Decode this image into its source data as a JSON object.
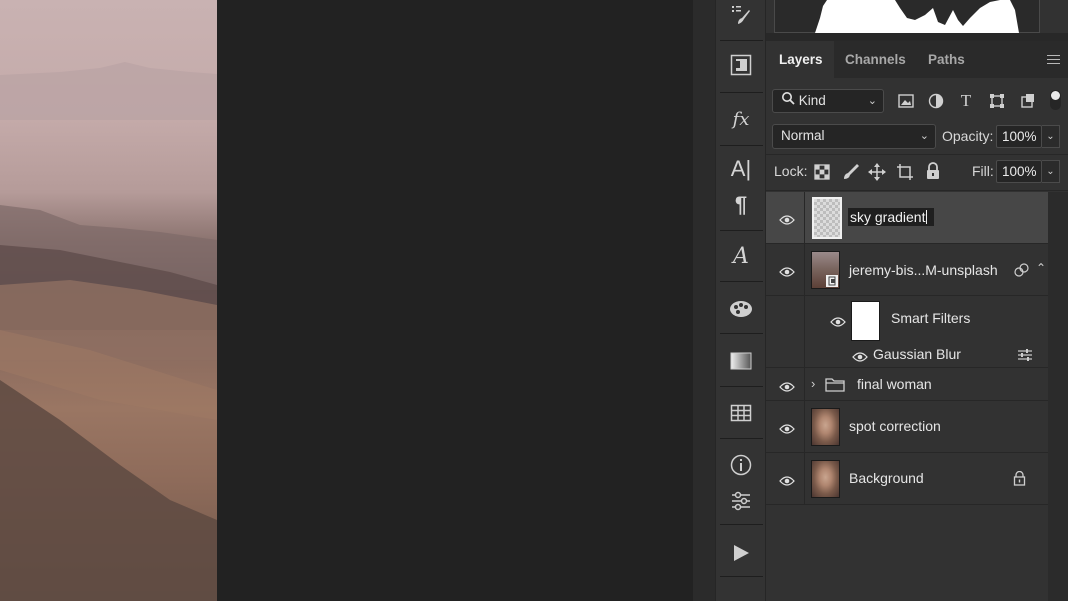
{
  "colors": {
    "panel_bg": "#323232",
    "selected_layer_bg": "#474747",
    "workspace_bg": "#222222"
  },
  "tools_strip": {
    "icons": [
      "brush-preset-icon",
      "artboard-icon",
      "fx-icon",
      "character-icon",
      "paragraph-icon",
      "glyphs-icon",
      "swatches-icon",
      "gradient-icon",
      "table-icon",
      "info-icon",
      "adjustments-icon",
      "play-icon"
    ]
  },
  "tabs": [
    {
      "label": "Layers",
      "active": true
    },
    {
      "label": "Channels",
      "active": false
    },
    {
      "label": "Paths",
      "active": false
    }
  ],
  "filter": {
    "kind_label": "Kind",
    "icons": [
      "image-filter-icon",
      "adjustment-filter-icon",
      "type-filter-icon",
      "shape-filter-icon",
      "smartobject-filter-icon"
    ]
  },
  "blend": {
    "mode": "Normal",
    "opacity_label": "Opacity:",
    "opacity_value": "100%",
    "fill_label": "Fill:",
    "fill_value": "100%",
    "lock_label": "Lock:"
  },
  "layers": {
    "sky": {
      "name": "sky gradient"
    },
    "photo": {
      "name": "jeremy-bis...M-unsplash"
    },
    "smart_filters": {
      "name": "Smart Filters"
    },
    "blur": {
      "name": "Gaussian Blur"
    },
    "group": {
      "name": "final woman"
    },
    "spot": {
      "name": "spot correction"
    },
    "background": {
      "name": "Background"
    }
  }
}
